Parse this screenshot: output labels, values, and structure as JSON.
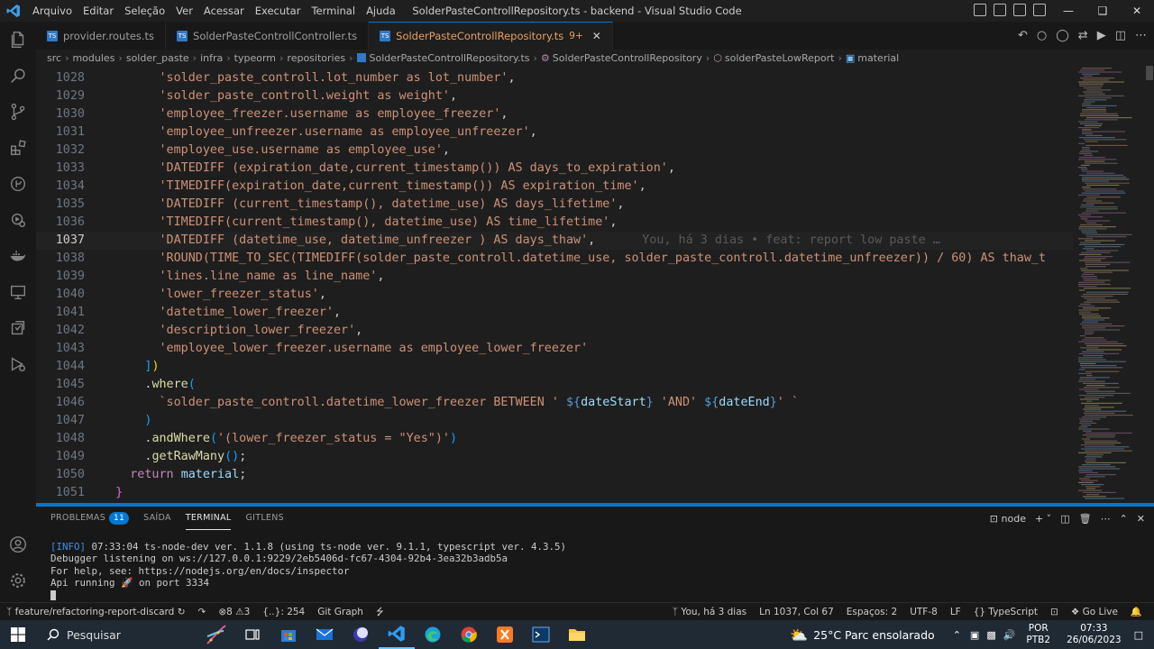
{
  "titlebar": {
    "logo": "vscode-logo",
    "menu": [
      "Arquivo",
      "Editar",
      "Seleção",
      "Ver",
      "Acessar",
      "Executar",
      "Terminal",
      "Ajuda"
    ],
    "title": "SolderPasteControllRepository.ts - backend - Visual Studio Code"
  },
  "tabs": [
    {
      "label": "provider.routes.ts",
      "active": false
    },
    {
      "label": "SolderPasteControllController.ts",
      "active": false
    },
    {
      "label": "SolderPasteControllRepository.ts",
      "badge": "9+",
      "active": true
    }
  ],
  "breadcrumbs": [
    "src",
    "modules",
    "solder_paste",
    "infra",
    "typeorm",
    "repositories",
    "SolderPasteControllRepository.ts",
    "SolderPasteControllRepository",
    "solderPasteLowReport",
    "material"
  ],
  "editor": {
    "current_line": 1037,
    "blame": "You, há 3 dias • feat: report low paste …"
  },
  "panel": {
    "tabs": [
      {
        "label": "PROBLEMAS",
        "badge": "11"
      },
      {
        "label": "SAÍDA"
      },
      {
        "label": "TERMINAL",
        "active": true
      },
      {
        "label": "GITLENS"
      }
    ],
    "terminal_name": "node",
    "terminal_lines": [
      "[INFO] 07:33:04 ts-node-dev ver. 1.1.8 (using ts-node ver. 9.1.1, typescript ver. 4.3.5)",
      "Debugger listening on ws://127.0.0.1:9229/2eb5406d-fc67-4304-92b4-3ea32b3adb5a",
      "For help, see: https://nodejs.org/en/docs/inspector",
      "Api running 🚀 on port 3334"
    ]
  },
  "statusbar": {
    "branch": "feature/refactoring-report-discard",
    "errors": "8",
    "warnings": "3",
    "selection": "{..}: 254",
    "git_graph": "Git Graph",
    "blame": "You, há 3 dias",
    "position": "Ln 1037, Col 67",
    "spaces": "Espaços: 2",
    "encoding": "UTF-8",
    "eol": "LF",
    "language": "TypeScript",
    "golive": "Go Live"
  },
  "taskbar": {
    "search": "Pesquisar",
    "weather": "25°C  Parc ensolarado",
    "lang1": "POR",
    "lang2": "PTB2",
    "time": "07:33",
    "date": "26/06/2023"
  },
  "colors": {
    "accent": "#0078d4",
    "string": "#ce9178",
    "keyword": "#c586c0",
    "function": "#dcdcaa",
    "variable": "#9cdcfe"
  }
}
